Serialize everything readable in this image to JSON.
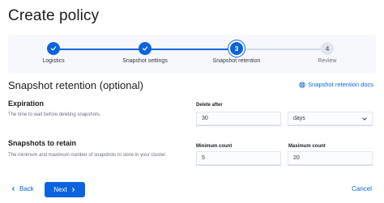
{
  "page": {
    "title": "Create policy"
  },
  "stepper": {
    "steps": [
      {
        "label": "Logistics",
        "status": "complete",
        "number": "1"
      },
      {
        "label": "Snapshot settings",
        "status": "complete",
        "number": "2"
      },
      {
        "label": "Snapshot retention",
        "status": "current",
        "number": "3"
      },
      {
        "label": "Review",
        "status": "incomplete",
        "number": "4"
      }
    ]
  },
  "retention": {
    "title": "Snapshot retention (optional)",
    "docs_link": "Snapshot retention docs",
    "expiration": {
      "title": "Expiration",
      "description": "The time to wait before deleting snapshots.",
      "delete_after_label": "Delete after",
      "delete_after_value": "30",
      "unit_value": "days"
    },
    "retain": {
      "title": "Snapshots to retain",
      "description": "The minimum and maximum number of snapshots to store in your cluster.",
      "min_label": "Minimum count",
      "min_value": "5",
      "max_label": "Maximum count",
      "max_value": "20"
    }
  },
  "footer": {
    "back_label": "Back",
    "next_label": "Next",
    "cancel_label": "Cancel"
  },
  "colors": {
    "primary": "#0b64dd",
    "stepper_bg": "#f7f8fc",
    "todo_circle": "#e0e5ee"
  },
  "icons": {
    "complete": "check-icon",
    "docs": "help-circle-icon",
    "back": "chevron-left-icon",
    "next": "chevron-right-icon",
    "select": "chevron-down-icon"
  }
}
